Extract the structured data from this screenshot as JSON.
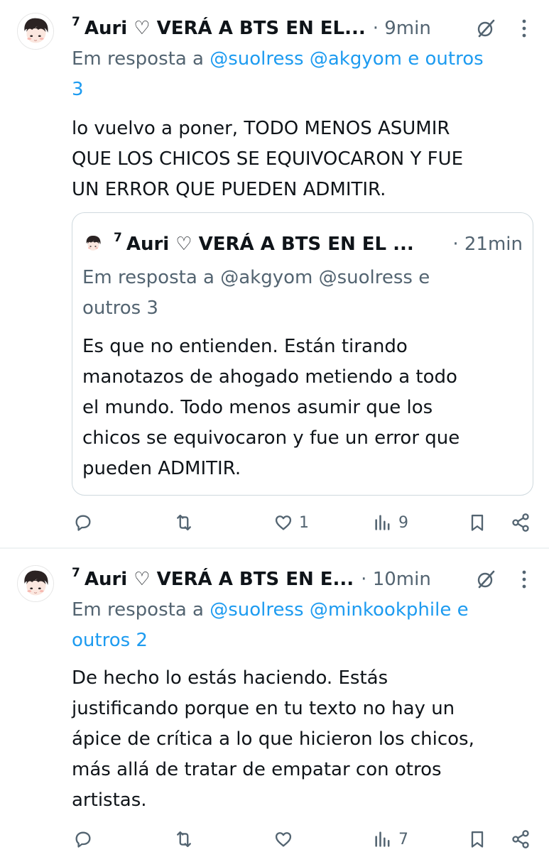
{
  "tweets": [
    {
      "badge": "7",
      "name": "Auri ♡ VERÁ A BTS EN EL...",
      "time": "· 9min",
      "reply_prefix": "Em resposta a ",
      "reply_mentions": "@suolress @akgyom",
      "reply_suffix": " e outros",
      "reply_count": "3",
      "body": [
        "lo vuelvo a poner, TODO MENOS ASUMIR",
        "QUE LOS CHICOS SE EQUIVOCARON Y FUE",
        "UN ERROR QUE PUEDEN ADMITIR."
      ],
      "quote": {
        "badge": "7",
        "name": "Auri ♡ VERÁ A BTS EN EL ...",
        "time": "· 21min",
        "reply_line1": "Em resposta a @akgyom @suolress e",
        "reply_line2": "outros 3",
        "body": [
          "Es que no entienden. Están tirando",
          "manotazos de ahogado metiendo a todo",
          "el mundo. Todo menos asumir que los",
          "chicos se equivocaron y fue un error que",
          "pueden ADMITIR."
        ]
      },
      "actions": {
        "replies": "",
        "retweets": "",
        "likes": "1",
        "views": "9"
      }
    },
    {
      "badge": "7",
      "name": "Auri ♡ VERÁ A BTS EN E...",
      "time": "· 10min",
      "reply_prefix": "Em resposta a ",
      "reply_mentions": "@suolress @minkookphile",
      "reply_suffix": " e",
      "reply_line2": "outros 2",
      "body": [
        "De hecho lo estás haciendo. Estás",
        "justificando porque en tu texto no hay un",
        "ápice de crítica a lo que hicieron los chicos,",
        "más allá de tratar de empatar con otros",
        "artistas."
      ],
      "actions": {
        "replies": "",
        "retweets": "",
        "likes": "",
        "views": "7"
      }
    }
  ],
  "icons": {
    "reply": "reply-icon",
    "retweet": "retweet-icon",
    "like": "heart-icon",
    "views": "views-icon",
    "bookmark": "bookmark-icon",
    "share": "share-icon",
    "grok": "grok-icon",
    "more": "more-icon"
  },
  "colors": {
    "text": "#0f1419",
    "secondary": "#536471",
    "link": "#1d9bf0",
    "border": "#cfd9de"
  }
}
